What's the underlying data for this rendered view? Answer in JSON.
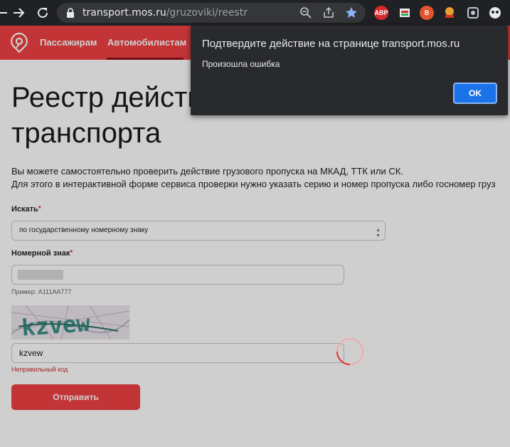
{
  "browser": {
    "url_domain": "transport.mos.ru",
    "url_path": "/gruzoviki/reestr",
    "extensions": [
      {
        "name": "adblock-plus-icon",
        "label": "ABP",
        "color": "#d62a2a"
      },
      {
        "name": "extension-2-icon",
        "label": "",
        "color": "#e8eaed"
      },
      {
        "name": "extension-3-icon",
        "label": "B",
        "color": "#e2542e"
      },
      {
        "name": "extension-4-icon",
        "label": "",
        "color": "#e8a030"
      },
      {
        "name": "extension-5-icon",
        "label": "",
        "color": "#bfc6d0"
      },
      {
        "name": "extension-6-icon",
        "label": "",
        "color": "#e8eaed"
      }
    ]
  },
  "header": {
    "nav": [
      {
        "label": "Пассажирам"
      },
      {
        "label": "Автомобилистам",
        "active": true
      }
    ]
  },
  "page": {
    "title_line1": "Реестр действ",
    "title_line2": "транспорта",
    "intro_line1": "Вы можете самостоятельно проверить действие грузового пропуска на МКАД, ТТК или СК.",
    "intro_line2": "Для этого в интерактивной форме сервиса проверки нужно указать серию и номер пропуска либо госномер груз",
    "search_label": "Искать",
    "search_value": "по государственному номерному знаку",
    "plate_label": "Номерной знак",
    "plate_hint": "Пример: А111АА777",
    "captcha_text": "kzvew",
    "captcha_value": "kzvew",
    "captcha_error": "Неправильный код",
    "submit_label": "Отправить",
    "required_mark": "*"
  },
  "dialog": {
    "title": "Подтвердите действие на странице transport.mos.ru",
    "message": "Произошла ошибка",
    "ok_label": "OK"
  },
  "colors": {
    "brand": "#ef4143",
    "dialog_bg": "#292a2d",
    "ok_button": "#1a73e8"
  }
}
